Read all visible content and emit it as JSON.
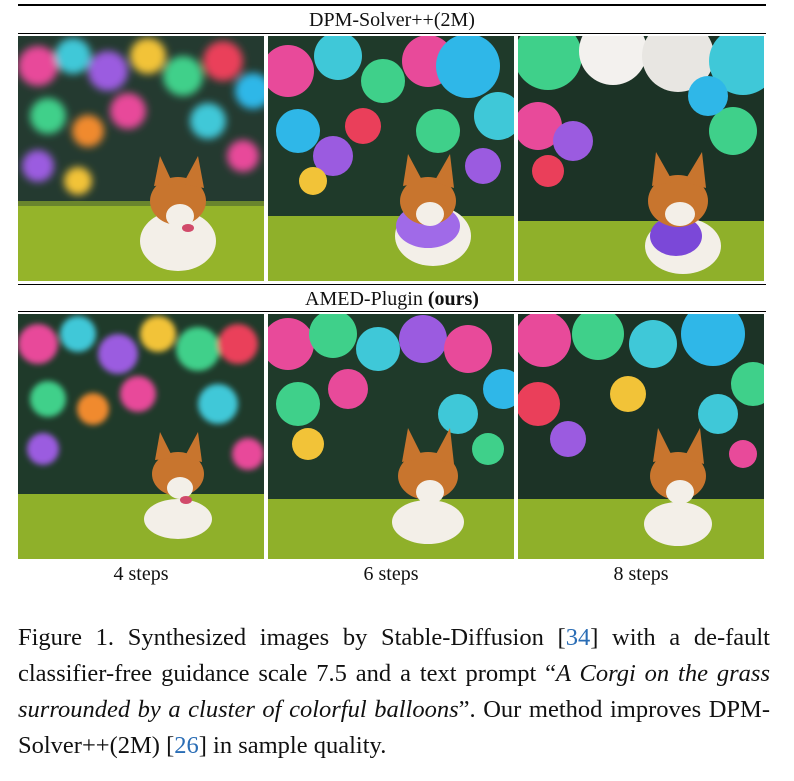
{
  "figure": {
    "top_row_title": "DPM-Solver++(2M)",
    "bottom_row_title_prefix": "AMED-Plugin ",
    "bottom_row_title_bold": "(ours)",
    "step_labels": [
      "4 steps",
      "6 steps",
      "8 steps"
    ],
    "rows": [
      {
        "method": "DPM-Solver++(2M)",
        "images": [
          {
            "steps": "4 steps",
            "subject": "corgi on grass with colorful balloons (blurry)"
          },
          {
            "steps": "6 steps",
            "subject": "corgi holding purple balloon, balloons above"
          },
          {
            "steps": "8 steps",
            "subject": "corgi with purple balloon, large balloons above"
          }
        ]
      },
      {
        "method": "AMED-Plugin (ours)",
        "images": [
          {
            "steps": "4 steps",
            "subject": "corgi lying on grass, balloons in background"
          },
          {
            "steps": "6 steps",
            "subject": "corgi on grass, colorful balloon cluster"
          },
          {
            "steps": "8 steps",
            "subject": "corgi on grass surrounded by balloons"
          }
        ]
      }
    ],
    "colors": {
      "grass": "#8fb02a",
      "forest": "#1f3a2a",
      "corgi_orange": "#c8752e",
      "corgi_white": "#f3efe8",
      "link_blue": "#2a6db5"
    }
  },
  "caption": {
    "part1": "Figure 1. Synthesized images by Stable-Diffusion [",
    "ref1": "34",
    "part2": "] with a de-fault classifier-free guidance scale 7.5 and a text prompt “",
    "prompt": "A Corgi on the grass surrounded by a cluster of colorful balloons",
    "part3": "”.  Our method improves DPM-Solver++(2M) [",
    "ref2": "26",
    "part4": "] in sample quality."
  }
}
